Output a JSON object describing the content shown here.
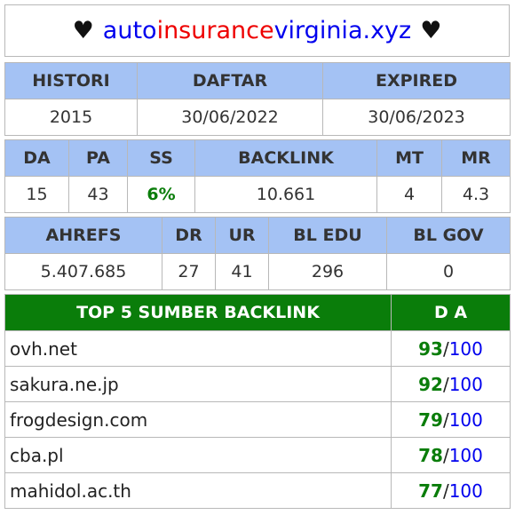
{
  "title": {
    "heart_left": "♥",
    "part1": "auto",
    "part2": "insurance",
    "part3": "virginia.xyz",
    "heart_right": "♥"
  },
  "info": {
    "headers": [
      "HISTORI",
      "DAFTAR",
      "EXPIRED"
    ],
    "values": [
      "2015",
      "30/06/2022",
      "30/06/2023"
    ]
  },
  "metrics": {
    "headers": [
      "DA",
      "PA",
      "SS",
      "BACKLINK",
      "MT",
      "MR"
    ],
    "values": [
      "15",
      "43",
      "6%",
      "10.661",
      "4",
      "4.3"
    ]
  },
  "ahrefs": {
    "headers": [
      "AHREFS",
      "DR",
      "UR",
      "BL EDU",
      "BL GOV"
    ],
    "values": [
      "5.407.685",
      "27",
      "41",
      "296",
      "0"
    ]
  },
  "top_backlinks": {
    "header_source": "TOP 5 SUMBER BACKLINK",
    "header_da": "D A",
    "slash": "/",
    "max": "100",
    "rows": [
      {
        "site": "ovh.net",
        "da": "93"
      },
      {
        "site": "sakura.ne.jp",
        "da": "92"
      },
      {
        "site": "frogdesign.com",
        "da": "79"
      },
      {
        "site": "cba.pl",
        "da": "78"
      },
      {
        "site": "mahidol.ac.th",
        "da": "77"
      }
    ]
  },
  "colors": {
    "header_blue": "#a4c2f4",
    "header_green": "#0a7d0a",
    "link_blue": "#0000ee",
    "accent_red": "#ee0000"
  }
}
